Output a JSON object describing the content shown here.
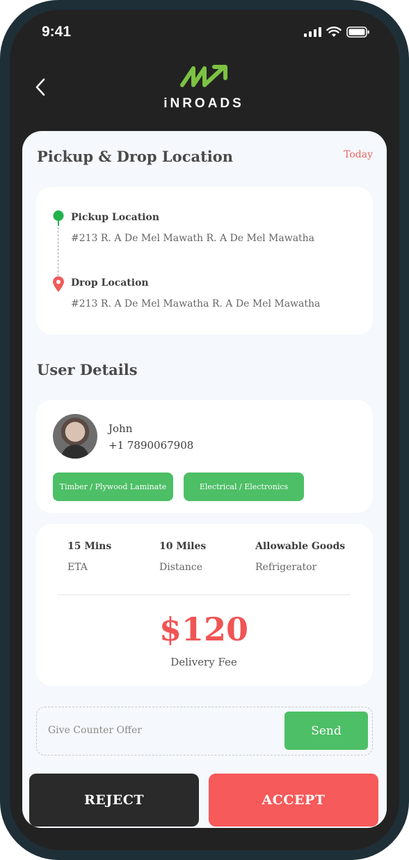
{
  "status": {
    "time": "9:41"
  },
  "brand": {
    "name": "iNROADS",
    "accent": "#7cc242"
  },
  "route": {
    "title": "Pickup & Drop Location",
    "date_label": "Today",
    "pickup_label": "Pickup Location",
    "pickup_address": "#213 R. A De Mel Mawath R. A De Mel Mawatha",
    "drop_label": "Drop Location",
    "drop_address": "#213 R. A De Mel Mawatha R. A De Mel Mawatha"
  },
  "user": {
    "title": "User Details",
    "name": "John",
    "phone": "+1 7890067908",
    "tags": [
      "Timber / Plywood Laminate",
      "Electrical / Electronics"
    ]
  },
  "trip": {
    "eta_value": "15 Mins",
    "eta_label": "ETA",
    "distance_value": "10 Miles",
    "distance_label": "Distance",
    "goods_value": "Allowable Goods",
    "goods_label": "Refrigerator",
    "fee": "$120",
    "fee_label": "Delivery Fee"
  },
  "offer": {
    "placeholder": "Give Counter Offer",
    "send_label": "Send"
  },
  "actions": {
    "reject_label": "REJECT",
    "accept_label": "ACCEPT"
  },
  "colors": {
    "green": "#4dbf66",
    "red": "#f65a5a",
    "dark": "#232222"
  }
}
